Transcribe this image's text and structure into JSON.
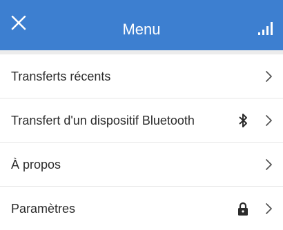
{
  "header": {
    "title": "Menu",
    "background_color": "#3d7fd0",
    "close_icon": "close-icon",
    "signal_icon": "signal-bars-icon"
  },
  "menu": {
    "items": [
      {
        "label": "Transferts récents",
        "trailing_icon": "chevron-right-icon"
      },
      {
        "label": "Transfert d'un dispositif Bluetooth",
        "status_icon": "bluetooth-icon",
        "trailing_icon": "chevron-right-icon"
      },
      {
        "label": "À propos",
        "trailing_icon": "chevron-right-icon"
      },
      {
        "label": "Paramètres",
        "status_icon": "lock-icon",
        "trailing_icon": "chevron-right-icon"
      }
    ]
  }
}
